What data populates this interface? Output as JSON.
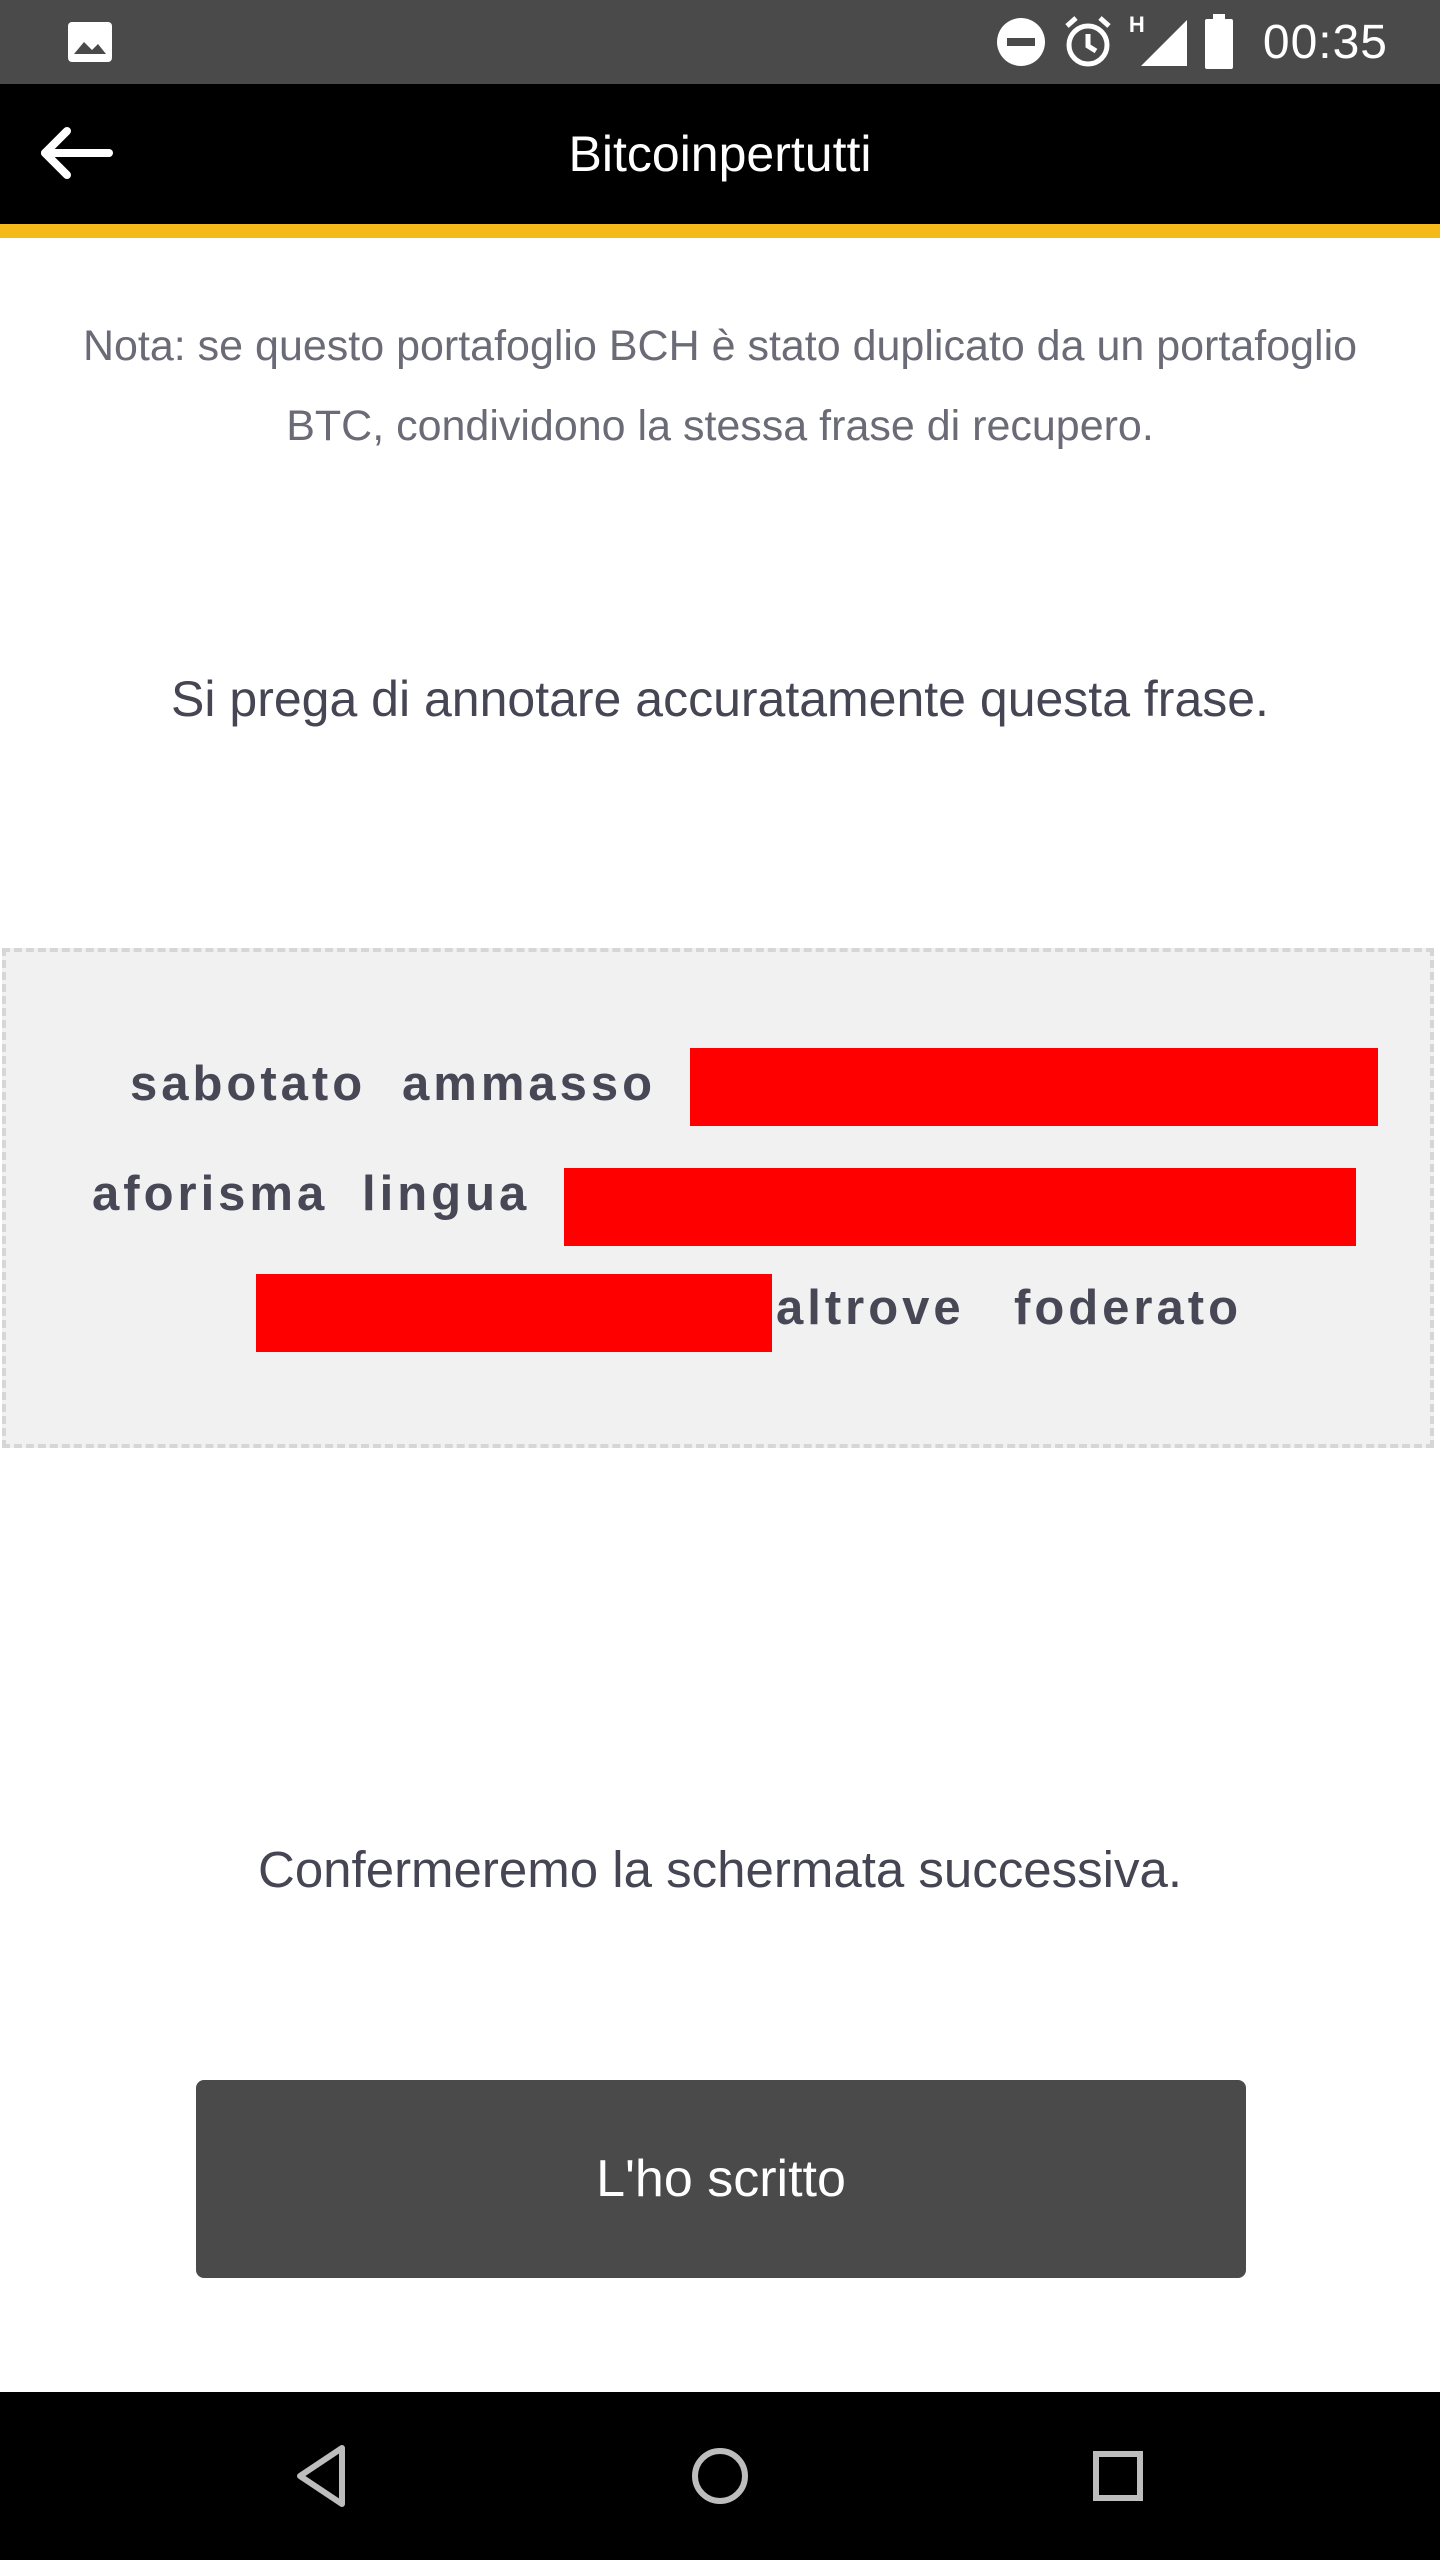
{
  "status_bar": {
    "time": "00:35",
    "network_label": "H",
    "icons": [
      "image-icon",
      "do-not-disturb-icon",
      "alarm-icon",
      "signal-icon",
      "battery-icon"
    ]
  },
  "app_bar": {
    "title": "Bitcoinpertutti",
    "back_icon": "arrow-left-icon",
    "accent_color": "#f5b91c"
  },
  "note": {
    "text": "Nota: se questo portafoglio BCH è stato duplicato da un portafoglio BTC, condividono la stessa frase di recupero."
  },
  "instruction": {
    "text": "Si prega di annotare accuratamente questa frase."
  },
  "phrase": {
    "words": {
      "w1": "sabotato",
      "w2": "ammasso",
      "w3": "aforisma",
      "w4": "lingua",
      "w5": "altrove",
      "w6": "foderato"
    },
    "redaction_color": "#ff0000"
  },
  "confirm": {
    "text": "Confermeremo la schermata successiva."
  },
  "button": {
    "label": "L'ho scritto"
  },
  "nav_bar": {
    "icons": [
      "back-triangle-icon",
      "home-circle-icon",
      "recents-square-icon"
    ]
  }
}
